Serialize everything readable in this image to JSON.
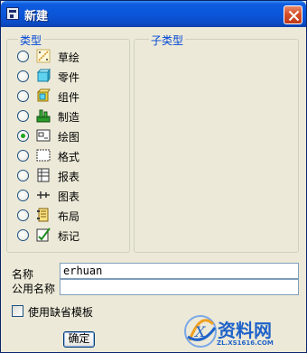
{
  "window": {
    "title": "新建",
    "close_icon": "close-icon"
  },
  "type_group": {
    "label": "类型",
    "selected_index": 5,
    "items": [
      {
        "label": "草绘",
        "icon": "sketch-icon"
      },
      {
        "label": "零件",
        "icon": "part-icon"
      },
      {
        "label": "组件",
        "icon": "assembly-icon"
      },
      {
        "label": "制造",
        "icon": "manufacturing-icon"
      },
      {
        "label": "绘图",
        "icon": "drawing-icon"
      },
      {
        "label": "格式",
        "icon": "format-icon"
      },
      {
        "label": "报表",
        "icon": "report-icon"
      },
      {
        "label": "图表",
        "icon": "diagram-icon"
      },
      {
        "label": "布局",
        "icon": "layout-icon"
      },
      {
        "label": "标记",
        "icon": "markup-icon"
      }
    ]
  },
  "subtype_group": {
    "label": "子类型"
  },
  "form": {
    "name_label": "名称",
    "name_value": "erhuan",
    "common_name_label": "公用名称",
    "common_name_value": "",
    "template_checkbox_label": "使用缺省模板",
    "template_checked": false
  },
  "buttons": {
    "ok_label": "确定"
  },
  "watermark": {
    "text": "资料网",
    "url": "ZL.XS1616.COM"
  },
  "colors": {
    "title_bar": "#0a55d8",
    "group_label": "#0046d5",
    "dialog_bg": "#ece9d8",
    "radio_selected": "#21a121"
  }
}
